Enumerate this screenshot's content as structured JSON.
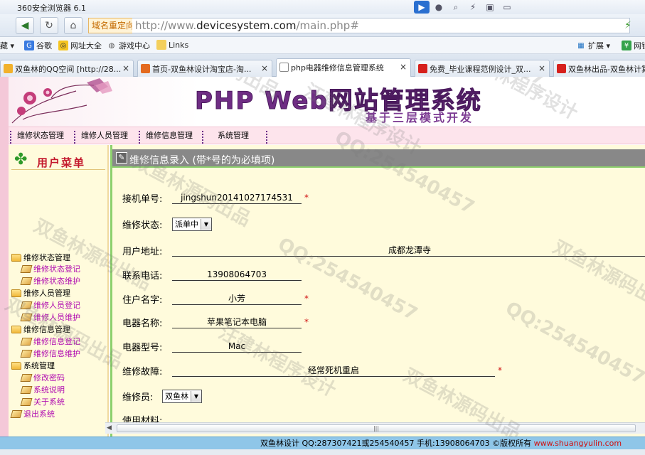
{
  "browser": {
    "app_title": "360安全浏览器 6.1",
    "dns_badge": "域名重定向",
    "url_prefix": "http://www.",
    "url_host": "devicesystem.com",
    "url_path": "/main.php#",
    "bookmarks": [
      {
        "label": "藏 ▾",
        "icon": "star-icon"
      },
      {
        "label": "谷歌",
        "icon": "google-icon"
      },
      {
        "label": "网址大全",
        "icon": "globe-icon"
      },
      {
        "label": "游戏中心",
        "icon": "gamepad-icon"
      },
      {
        "label": "Links",
        "icon": "folder-icon"
      }
    ],
    "right_bookmarks": [
      {
        "label": "扩展 ▾"
      },
      {
        "label": "网银"
      }
    ],
    "tabs": [
      {
        "label": "双鱼林的QQ空间 [http://28...",
        "color": "#f2b12b"
      },
      {
        "label": "首页-双鱼林设计淘宝店-淘...",
        "color": "#e46a1f"
      },
      {
        "label": "php电器维修信息管理系统",
        "color": "#ffffff",
        "active": true
      },
      {
        "label": "免费_毕业课程范例设计_双...",
        "color": "#d6201c"
      },
      {
        "label": "双鱼林出品-双鱼林计算",
        "color": "#d6201c"
      }
    ]
  },
  "banner": {
    "title": "PHP Web网站管理系统",
    "subtitle": "基于三层模式开发"
  },
  "topnav": [
    "维修状态管理",
    "维修人员管理",
    "维修信息管理",
    "系统管理"
  ],
  "sidebar": {
    "heading": "用户菜单",
    "tree": [
      {
        "label": "维修状态管理",
        "type": "cat"
      },
      {
        "label": "维修状态登记",
        "type": "leaf"
      },
      {
        "label": "维修状态维护",
        "type": "leaf"
      },
      {
        "label": "维修人员管理",
        "type": "cat"
      },
      {
        "label": "维修人员登记",
        "type": "leaf"
      },
      {
        "label": "维修人员维护",
        "type": "leaf"
      },
      {
        "label": "维修信息管理",
        "type": "cat"
      },
      {
        "label": "维修信息登记",
        "type": "leaf"
      },
      {
        "label": "维修信息维护",
        "type": "leaf"
      },
      {
        "label": "系统管理",
        "type": "cat"
      },
      {
        "label": "修改密码",
        "type": "leaf"
      },
      {
        "label": "系统说明",
        "type": "leaf"
      },
      {
        "label": "关于系统",
        "type": "leaf"
      },
      {
        "label": "退出系统",
        "type": "exit"
      }
    ]
  },
  "form": {
    "header": "维修信息录入 (带*号的为必填项)",
    "order_no_label": "接机单号:",
    "order_no": "jingshun20141027174531",
    "status_label": "维修状态:",
    "status": "派单中",
    "address_label": "用户地址:",
    "address": "成都龙潭寺",
    "phone_label": "联系电话:",
    "phone": "13908064703",
    "name_label": "住户名字:",
    "name": "小芳",
    "appliance_label": "电器名称:",
    "appliance": "苹果笔记本电脑",
    "model_label": "电器型号:",
    "model": "Mac",
    "fault_label": "维修故障:",
    "fault": "经常死机重启",
    "worker_label": "维修员:",
    "worker": "双鱼林",
    "material_label": "使用材料:",
    "required_mark": "*"
  },
  "footer": {
    "copy": "双鱼林设计 QQ:287307421或254540457 手机:13908064703 ©版权所有 ",
    "link": "www.shuangyulin.com"
  },
  "watermarks": {
    "qq": "QQ:254540457",
    "a": "双鱼林源码出品",
    "b": "汪建林程序设计"
  }
}
